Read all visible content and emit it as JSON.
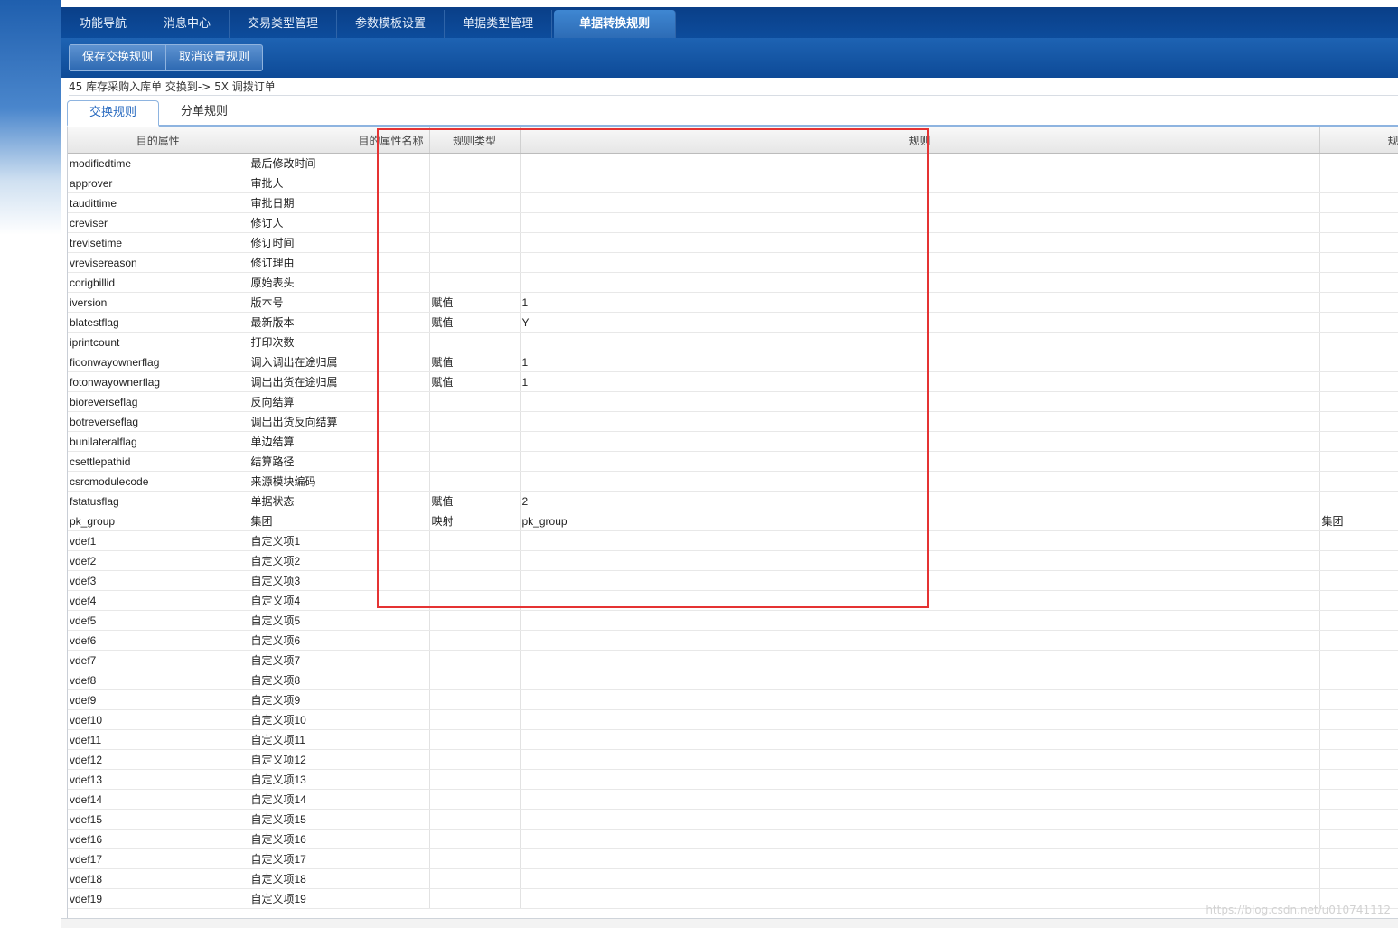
{
  "nav": {
    "tabs": [
      {
        "label": "功能导航",
        "active": false
      },
      {
        "label": "消息中心",
        "active": false
      },
      {
        "label": "交易类型管理",
        "active": false
      },
      {
        "label": "参数模板设置",
        "active": false
      },
      {
        "label": "单据类型管理",
        "active": false
      },
      {
        "label": "单据转换规则",
        "active": true
      }
    ]
  },
  "toolbar": {
    "save_label": "保存交换规则",
    "cancel_label": "取消设置规则"
  },
  "caption": "45 库存采购入库单 交换到-> 5X 调拨订单",
  "subtabs": [
    {
      "label": "交换规则",
      "active": true
    },
    {
      "label": "分单规则",
      "active": false
    }
  ],
  "grid": {
    "columns": [
      "目的属性",
      "目的属性名称",
      "规则类型",
      "规则",
      "规"
    ],
    "rows": [
      {
        "attr": "modifiedtime",
        "name": "最后修改时间",
        "type": "",
        "rule": "",
        "extra": ""
      },
      {
        "attr": "approver",
        "name": "审批人",
        "type": "",
        "rule": "",
        "extra": ""
      },
      {
        "attr": "taudittime",
        "name": "审批日期",
        "type": "",
        "rule": "",
        "extra": ""
      },
      {
        "attr": "creviser",
        "name": "修订人",
        "type": "",
        "rule": "",
        "extra": ""
      },
      {
        "attr": "trevisetime",
        "name": "修订时间",
        "type": "",
        "rule": "",
        "extra": ""
      },
      {
        "attr": "vrevisereason",
        "name": "修订理由",
        "type": "",
        "rule": "",
        "extra": ""
      },
      {
        "attr": "corigbillid",
        "name": "原始表头",
        "type": "",
        "rule": "",
        "extra": ""
      },
      {
        "attr": "iversion",
        "name": "版本号",
        "type": "赋值",
        "rule": "1",
        "extra": ""
      },
      {
        "attr": "blatestflag",
        "name": "最新版本",
        "type": "赋值",
        "rule": "Y",
        "extra": ""
      },
      {
        "attr": "iprintcount",
        "name": "打印次数",
        "type": "",
        "rule": "",
        "extra": ""
      },
      {
        "attr": "fioonwayownerflag",
        "name": "调入调出在途归属",
        "type": "赋值",
        "rule": "1",
        "extra": ""
      },
      {
        "attr": "fotonwayownerflag",
        "name": "调出出货在途归属",
        "type": "赋值",
        "rule": "1",
        "extra": ""
      },
      {
        "attr": "bioreverseflag",
        "name": "反向结算",
        "type": "",
        "rule": "",
        "extra": ""
      },
      {
        "attr": "botreverseflag",
        "name": "调出出货反向结算",
        "type": "",
        "rule": "",
        "extra": ""
      },
      {
        "attr": "bunilateralflag",
        "name": "单边结算",
        "type": "",
        "rule": "",
        "extra": ""
      },
      {
        "attr": "csettlepathid",
        "name": "结算路径",
        "type": "",
        "rule": "",
        "extra": ""
      },
      {
        "attr": "csrcmodulecode",
        "name": "来源模块编码",
        "type": "",
        "rule": "",
        "extra": ""
      },
      {
        "attr": "fstatusflag",
        "name": "单据状态",
        "type": "赋值",
        "rule": "2",
        "extra": ""
      },
      {
        "attr": "pk_group",
        "name": "集团",
        "type": "映射",
        "rule": "pk_group",
        "extra": "集团"
      },
      {
        "attr": "vdef1",
        "name": "自定义项1",
        "type": "",
        "rule": "",
        "extra": ""
      },
      {
        "attr": "vdef2",
        "name": "自定义项2",
        "type": "",
        "rule": "",
        "extra": ""
      },
      {
        "attr": "vdef3",
        "name": "自定义项3",
        "type": "",
        "rule": "",
        "extra": ""
      },
      {
        "attr": "vdef4",
        "name": "自定义项4",
        "type": "",
        "rule": "",
        "extra": ""
      },
      {
        "attr": "vdef5",
        "name": "自定义项5",
        "type": "",
        "rule": "",
        "extra": ""
      },
      {
        "attr": "vdef6",
        "name": "自定义项6",
        "type": "",
        "rule": "",
        "extra": ""
      },
      {
        "attr": "vdef7",
        "name": "自定义项7",
        "type": "",
        "rule": "",
        "extra": ""
      },
      {
        "attr": "vdef8",
        "name": "自定义项8",
        "type": "",
        "rule": "",
        "extra": ""
      },
      {
        "attr": "vdef9",
        "name": "自定义项9",
        "type": "",
        "rule": "",
        "extra": ""
      },
      {
        "attr": "vdef10",
        "name": "自定义项10",
        "type": "",
        "rule": "",
        "extra": ""
      },
      {
        "attr": "vdef11",
        "name": "自定义项11",
        "type": "",
        "rule": "",
        "extra": ""
      },
      {
        "attr": "vdef12",
        "name": "自定义项12",
        "type": "",
        "rule": "",
        "extra": ""
      },
      {
        "attr": "vdef13",
        "name": "自定义项13",
        "type": "",
        "rule": "",
        "extra": ""
      },
      {
        "attr": "vdef14",
        "name": "自定义项14",
        "type": "",
        "rule": "",
        "extra": ""
      },
      {
        "attr": "vdef15",
        "name": "自定义项15",
        "type": "",
        "rule": "",
        "extra": ""
      },
      {
        "attr": "vdef16",
        "name": "自定义项16",
        "type": "",
        "rule": "",
        "extra": ""
      },
      {
        "attr": "vdef17",
        "name": "自定义项17",
        "type": "",
        "rule": "",
        "extra": ""
      },
      {
        "attr": "vdef18",
        "name": "自定义项18",
        "type": "",
        "rule": "",
        "extra": ""
      },
      {
        "attr": "vdef19",
        "name": "自定义项19",
        "type": "",
        "rule": "",
        "extra": ""
      }
    ]
  },
  "watermark": "https://blog.csdn.net/u010741112",
  "colors": {
    "highlight": "#e53333",
    "nav_bg": "#0d4e9f",
    "active_subtab": "#2a6bc0"
  }
}
